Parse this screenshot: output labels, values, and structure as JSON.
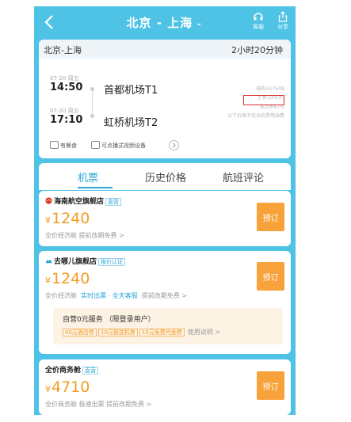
{
  "header": {
    "title": "北京 - 上海",
    "title_caret": "⌄",
    "service_label": "客服",
    "share_label": "分享"
  },
  "flight": {
    "route": "北京-上海",
    "duration": "2小时20分钟",
    "depart": {
      "date": "07-20 周五",
      "time": "14:50",
      "airport": "首都机场T1"
    },
    "arrive": {
      "date": "07-20 周五",
      "time": "17:10",
      "airport": "虹桥机场T2"
    },
    "notes": [
      "海航HU7608",
      "空客330(大)",
      "准点率87%",
      "以下价格不包含机票燃油费"
    ],
    "chips": {
      "meal": "有餐食",
      "video": "可点播式视频设备"
    }
  },
  "tabs": [
    "机票",
    "历史价格",
    "航班评论"
  ],
  "offers": [
    {
      "vendor": "海南航空旗舰店",
      "tag": "直营",
      "price": "1240",
      "currency": "¥",
      "sub": "全价经济舱  提前改期免费 >",
      "button": "预订"
    },
    {
      "vendor": "去哪儿旗舰店",
      "tag": "报价认证",
      "price": "1240",
      "currency": "¥",
      "sub_prefix": "全价经济舱",
      "sub_highlight": "实时出票 · 全天客服",
      "sub_suffix": "提前改期免费 >",
      "button": "预订",
      "promo": {
        "title": "自营0元服务 （限登录用户）",
        "pills": [
          "40元酒店券",
          "10元接送机券",
          "10元免费代金券"
        ],
        "link": "使用说明 >"
      }
    },
    {
      "vendor": "全价商务舱",
      "tag": "直营",
      "price": "4710",
      "currency": "¥",
      "sub": "全价商务舱  极速出票  提前改期免费 >",
      "button": "预订"
    }
  ],
  "colors": {
    "accent": "#4fc3e6",
    "price": "#f39c23",
    "button": "#f7a23a",
    "highlight_box": "#d9332b"
  }
}
